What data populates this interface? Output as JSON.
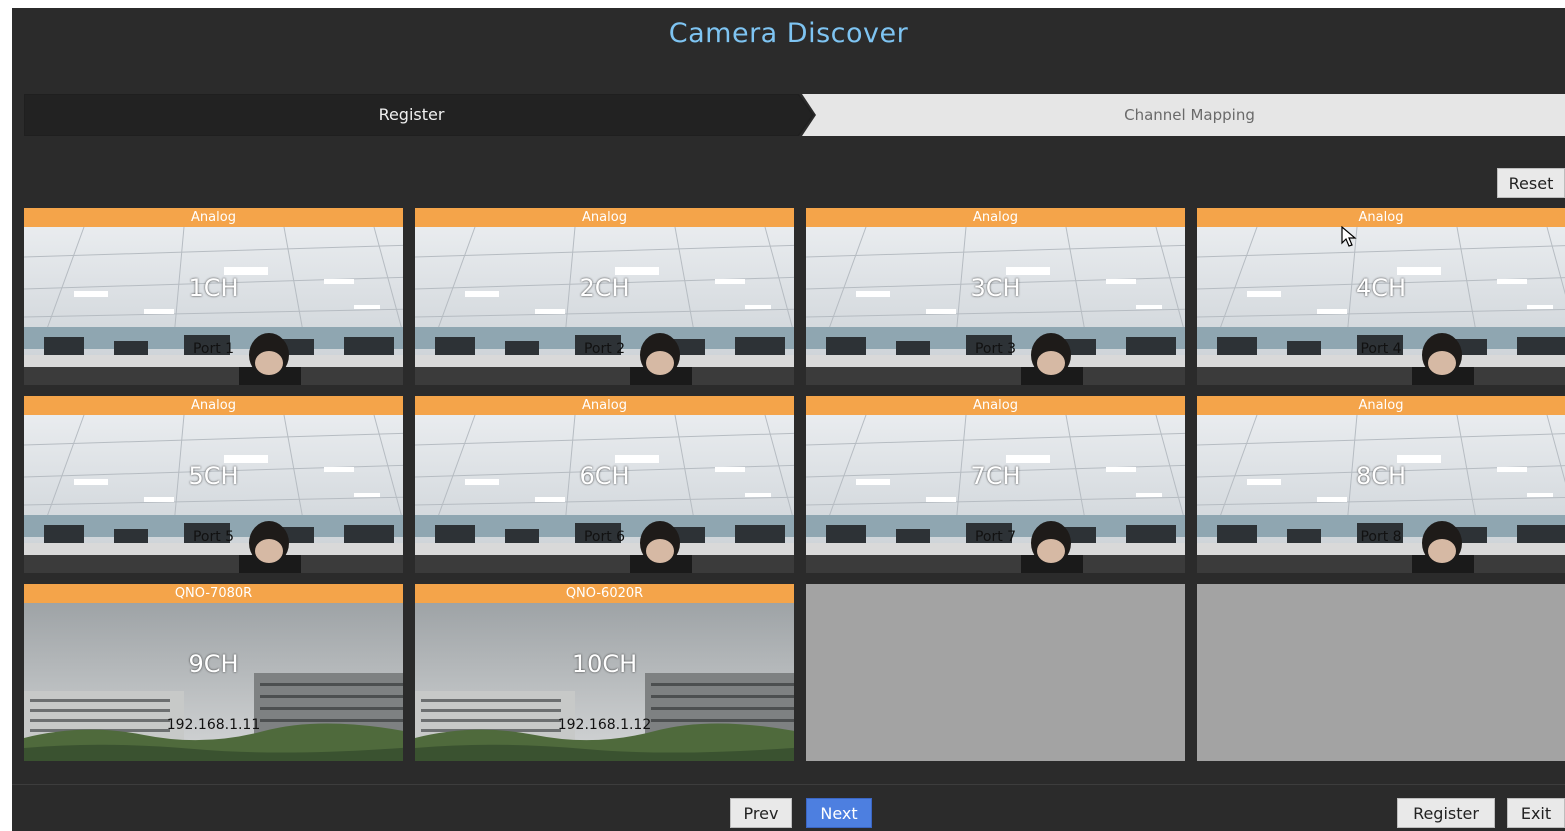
{
  "window": {
    "title": "Camera Discover"
  },
  "steps": [
    {
      "label": "Register",
      "active": true
    },
    {
      "label": "Channel Mapping",
      "active": false
    }
  ],
  "toolbar": {
    "reset_label": "Reset"
  },
  "tiles": [
    {
      "header": "Analog",
      "channel": "1CH",
      "source": "Port 1"
    },
    {
      "header": "Analog",
      "channel": "2CH",
      "source": "Port 2"
    },
    {
      "header": "Analog",
      "channel": "3CH",
      "source": "Port 3"
    },
    {
      "header": "Analog",
      "channel": "4CH",
      "source": "Port 4"
    },
    {
      "header": "Analog",
      "channel": "5CH",
      "source": "Port 5"
    },
    {
      "header": "Analog",
      "channel": "6CH",
      "source": "Port 6"
    },
    {
      "header": "Analog",
      "channel": "7CH",
      "source": "Port 7"
    },
    {
      "header": "Analog",
      "channel": "8CH",
      "source": "Port 8"
    },
    {
      "header": "QNO-7080R",
      "channel": "9CH",
      "source": "192.168.1.11"
    },
    {
      "header": "QNO-6020R",
      "channel": "10CH",
      "source": "192.168.1.12"
    }
  ],
  "footer": {
    "prev_label": "Prev",
    "next_label": "Next",
    "register_label": "Register",
    "exit_label": "Exit"
  },
  "colors": {
    "accent": "#7ec4f2",
    "tile_header": "#f4a44a",
    "primary_button": "#4d7fe0",
    "empty_tile": "#a3a3a3"
  }
}
